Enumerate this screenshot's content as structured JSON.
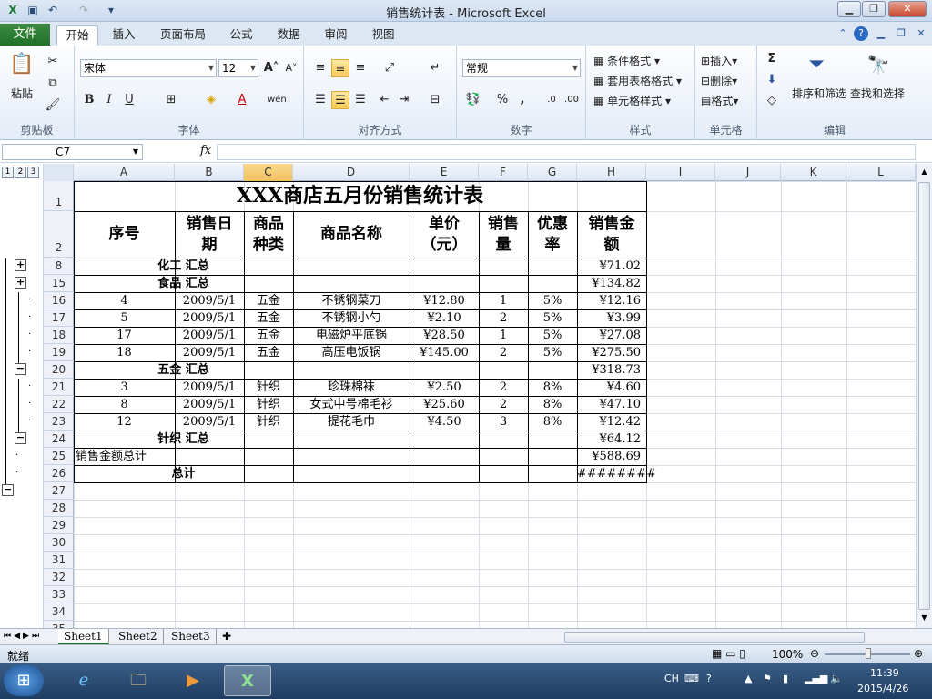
{
  "window": {
    "title": "销售统计表 - Microsoft Excel"
  },
  "ribbon_tabs": {
    "file": "文件",
    "home": "开始",
    "insert": "插入",
    "layout": "页面布局",
    "formulas": "公式",
    "data": "数据",
    "review": "审阅",
    "view": "视图"
  },
  "ribbon": {
    "paste": "粘贴",
    "font_name": "宋体",
    "font_size": "12",
    "number_format": "常规",
    "cond_format": "条件格式",
    "table_format": "套用表格格式",
    "cell_style": "单元格样式",
    "insert": "插入",
    "delete": "删除",
    "format": "格式",
    "sort_filter": "排序和筛选",
    "find_select": "查找和选择",
    "groups": {
      "clipboard": "剪贴板",
      "font": "字体",
      "align": "对齐方式",
      "number": "数字",
      "styles": "样式",
      "cells": "单元格",
      "edit": "编辑"
    }
  },
  "formula_bar": {
    "name_box": "C7",
    "fx": "fx",
    "content": ""
  },
  "columns": [
    "A",
    "B",
    "C",
    "D",
    "E",
    "F",
    "G",
    "H",
    "I",
    "J",
    "K",
    "L"
  ],
  "outline_levels": [
    "1",
    "2",
    "3"
  ],
  "sheet": {
    "title": "XXX商店五月份销售统计表",
    "headers": {
      "seq": "序号",
      "date1": "销售日",
      "date2": "期",
      "kind1": "商品",
      "kind2": "种类",
      "name": "商品名称",
      "price1": "单价",
      "price2": "（元）",
      "qty1": "销售",
      "qty2": "量",
      "disc1": "优惠",
      "disc2": "率",
      "amt1": "销售金",
      "amt2": "额"
    },
    "rows": [
      {
        "row": "8",
        "label": "化工 汇总",
        "amount": "¥71.02"
      },
      {
        "row": "15",
        "label": "食品 汇总",
        "amount": "¥134.82"
      },
      {
        "row": "16",
        "seq": "4",
        "date": "2009/5/1",
        "kind": "五金",
        "name": "不锈钢菜刀",
        "price": "¥12.80",
        "qty": "1",
        "disc": "5%",
        "amount": "¥12.16"
      },
      {
        "row": "17",
        "seq": "5",
        "date": "2009/5/1",
        "kind": "五金",
        "name": "不锈钢小勺",
        "price": "¥2.10",
        "qty": "2",
        "disc": "5%",
        "amount": "¥3.99"
      },
      {
        "row": "18",
        "seq": "17",
        "date": "2009/5/1",
        "kind": "五金",
        "name": "电磁炉平底锅",
        "price": "¥28.50",
        "qty": "1",
        "disc": "5%",
        "amount": "¥27.08"
      },
      {
        "row": "19",
        "seq": "18",
        "date": "2009/5/1",
        "kind": "五金",
        "name": "高压电饭锅",
        "price": "¥145.00",
        "qty": "2",
        "disc": "5%",
        "amount": "¥275.50"
      },
      {
        "row": "20",
        "label": "五金 汇总",
        "amount": "¥318.73"
      },
      {
        "row": "21",
        "seq": "3",
        "date": "2009/5/1",
        "kind": "针织",
        "name": "珍珠棉袜",
        "price": "¥2.50",
        "qty": "2",
        "disc": "8%",
        "amount": "¥4.60"
      },
      {
        "row": "22",
        "seq": "8",
        "date": "2009/5/1",
        "kind": "针织",
        "name": "女式中号棉毛衫",
        "price": "¥25.60",
        "qty": "2",
        "disc": "8%",
        "amount": "¥47.10"
      },
      {
        "row": "23",
        "seq": "12",
        "date": "2009/5/1",
        "kind": "针织",
        "name": "提花毛巾",
        "price": "¥4.50",
        "qty": "3",
        "disc": "8%",
        "amount": "¥12.42"
      },
      {
        "row": "24",
        "label": "针织 汇总",
        "amount": "¥64.12"
      },
      {
        "row": "25",
        "seq": "销售金额总计",
        "amount": "¥588.69"
      },
      {
        "row": "26",
        "label": "总计",
        "amount": "########"
      }
    ],
    "empty_rows": [
      "27",
      "28",
      "29",
      "30",
      "31",
      "32",
      "33",
      "34",
      "35"
    ]
  },
  "sheet_tabs": [
    "Sheet1",
    "Sheet2",
    "Sheet3"
  ],
  "status": {
    "ready": "就绪",
    "zoom": "100%"
  },
  "taskbar": {
    "ime": "CH",
    "time": "11:39",
    "date": "2015/4/26"
  },
  "icons": [
    "save-icon",
    "undo-icon",
    "redo-icon",
    "help-icon",
    "minimize-icon",
    "restore-icon",
    "close-icon",
    "paste-icon",
    "cut-icon",
    "copy-icon",
    "format-painter-icon",
    "bold-icon",
    "italic-icon",
    "underline-icon",
    "sort-filter-icon",
    "find-icon",
    "windows-start-icon",
    "ie-icon",
    "explorer-icon",
    "media-icon",
    "excel-icon"
  ]
}
